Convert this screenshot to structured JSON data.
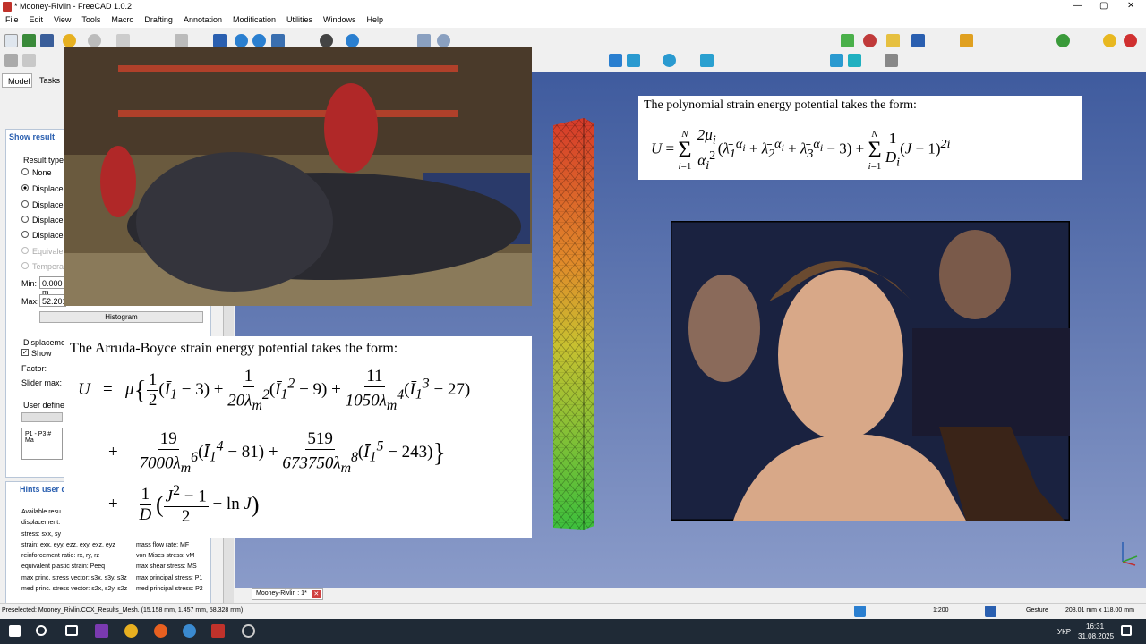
{
  "window": {
    "title": "* Mooney-Rivlin - FreeCAD 1.0.2",
    "min": "—",
    "max": "▢",
    "close": "✕"
  },
  "menu": [
    "File",
    "Edit",
    "View",
    "Tools",
    "Macro",
    "Drafting",
    "Annotation",
    "Modification",
    "Utilities",
    "Windows",
    "Help"
  ],
  "panel": {
    "tabs": [
      "Model",
      "Tasks"
    ],
    "show_result": "Show result",
    "result_type": "Result type",
    "radios": [
      "None",
      "Displacement",
      "Displacement",
      "Displacement",
      "Displacement",
      "Equivalent",
      "Temperature"
    ],
    "min_label": "Min:",
    "min_value": "0.000 m",
    "max_label": "Max:",
    "max_value": "52.201",
    "histogram": "Histogram",
    "displacement": "Displacement",
    "show": "Show",
    "factor": "Factor:",
    "slider_max": "Slider max:",
    "user_defined": "User defined",
    "user_expr": "P1 - P3 # Ma",
    "hints_title": "Hints user de",
    "hints_left": [
      "Available resu",
      "displacement:",
      "stress: sxx, sy",
      "strain: exx, eyy, ezz, exy, exz, eyz",
      "reinforcement ratio: rx, ry, rz",
      "equivalent plastic strain: Peeq",
      "max princ. stress vector: s3x, s3y, s3z",
      "med princ. stress vector: s2x, s2y, s2z"
    ],
    "hints_right": [
      "",
      "",
      "",
      "mass flow rate: MF",
      "von Mises stress: vM",
      "max shear stress: MS",
      "max principal stress: P1",
      "med principal stress: P2"
    ]
  },
  "overlays": {
    "arruda_intro": "The Arruda-Boyce strain energy potential takes the form:",
    "poly_intro": "The polynomial strain energy potential takes the form:"
  },
  "doc_tab": "Mooney-Rivlin : 1*",
  "status": {
    "preselected": "Preselected: Mooney_Rivlin.CCX_Results_Mesh. (15.158 mm, 1.457 mm, 58.328 mm)",
    "scale": "1:200",
    "nav": "Gesture",
    "dims": "208.01 mm x 118.00 mm"
  },
  "taskbar": {
    "lang": "УКР",
    "time": "16:31",
    "date": "31.08.2025"
  },
  "colors": {
    "accent": "#2a5fb0",
    "mesh_top": "#d63a2a",
    "mesh_mid": "#e0c030",
    "mesh_bottom": "#3cbf3c"
  }
}
